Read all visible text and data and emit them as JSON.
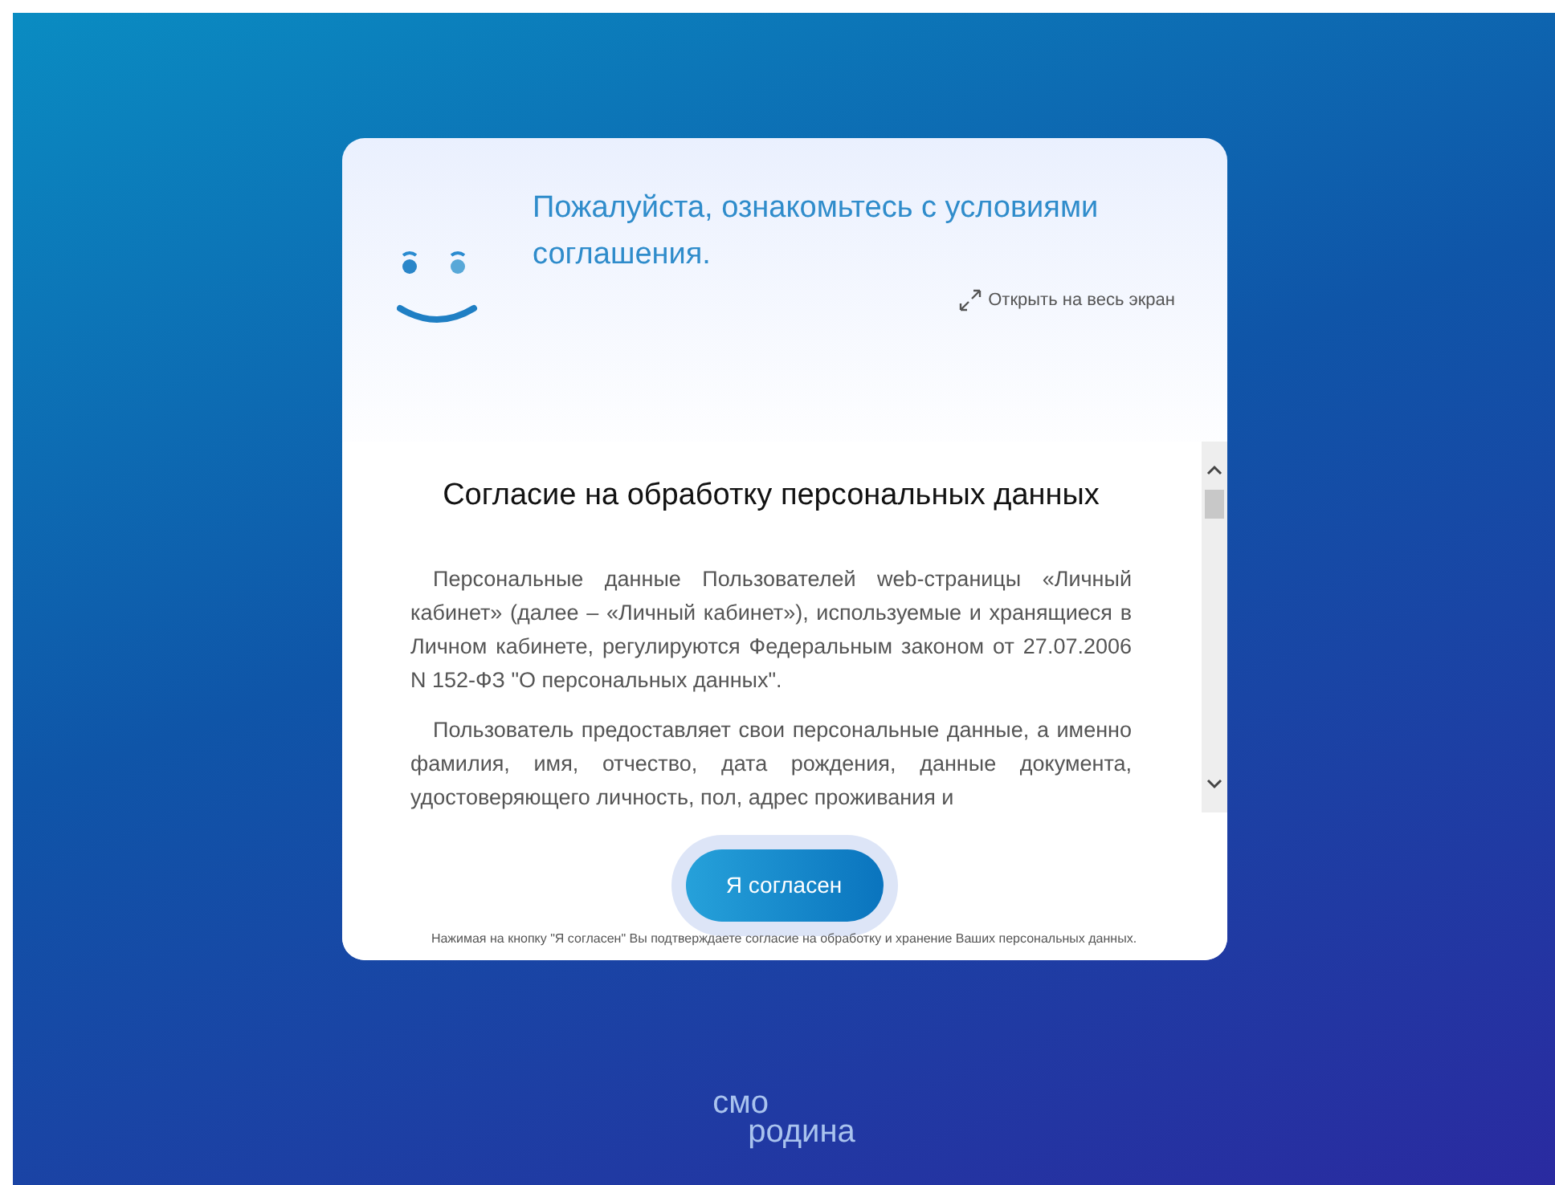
{
  "dialog": {
    "heading": "Пожалуйста, ознакомьтесь с условиями соглашения.",
    "fullscreen_link": "Открыть на весь экран",
    "document": {
      "title": "Согласие на обработку персональных данных",
      "paragraphs": [
        "Персональные данные Пользователей web-страницы «Личный кабинет» (далее – «Личный кабинет»), используемые и хранящиеся в Личном кабинете, регулируются Федеральным законом от 27.07.2006 N 152-ФЗ \"О персональных данных\".",
        "Пользователь предоставляет свои персональные данные, а именно фамилия, имя, отчество, дата рождения, данные документа, удостоверяющего личность, пол, адрес проживания и"
      ]
    },
    "agree_button": "Я согласен",
    "footnote": "Нажимая на кнопку \"Я согласен\" Вы подтверждаете согласие на обработку и хранение Ваших персональных данных."
  },
  "logo": {
    "top": "смо",
    "bottom": "родина"
  }
}
